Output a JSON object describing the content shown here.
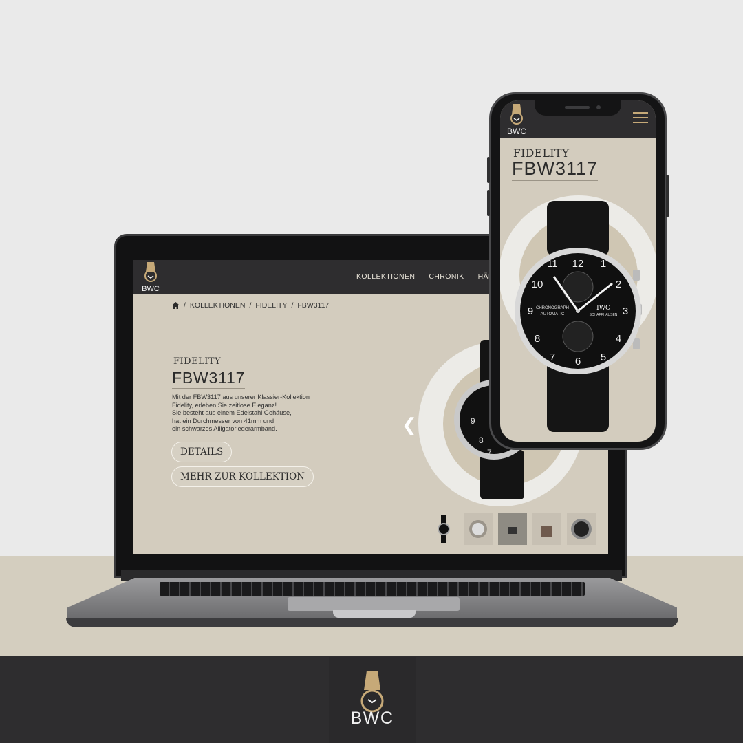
{
  "brand": {
    "name": "BWC",
    "accent": "#c6a978",
    "dark": "#2e2d2f",
    "beige": "#d3ccbe"
  },
  "desktop": {
    "nav": [
      "KOLLEKTIONEN",
      "CHRONIK",
      "HÄND"
    ],
    "breadcrumb": [
      "KOLLEKTIONEN",
      "FIDELITY",
      "FBW3117"
    ],
    "collection": "FIDELITY",
    "model": "FBW3117",
    "description": [
      "Mit der FBW3117 aus unserer Klassier-Kollektion",
      "Fidelity, erleben Sie zeitlose Eleganz!",
      "Sie besteht aus einem Edelstahl Gehäuse,",
      "hat ein Durchmesser von 41mm und",
      "ein schwarzes Alligatorlederarmband."
    ],
    "buttons": {
      "details": "DETAILS",
      "collection": "MEHR ZUR KOLLEKTION"
    },
    "thumbnail_count": 5
  },
  "mobile": {
    "collection": "FIDELITY",
    "model": "FBW3117",
    "menu_icon": "hamburger-icon"
  },
  "watch_dial": {
    "brand": "IWC",
    "text1": "CHRONOGRAPH",
    "text2": "AUTOMATIC",
    "text3": "SCHAFFHAUSEN"
  }
}
